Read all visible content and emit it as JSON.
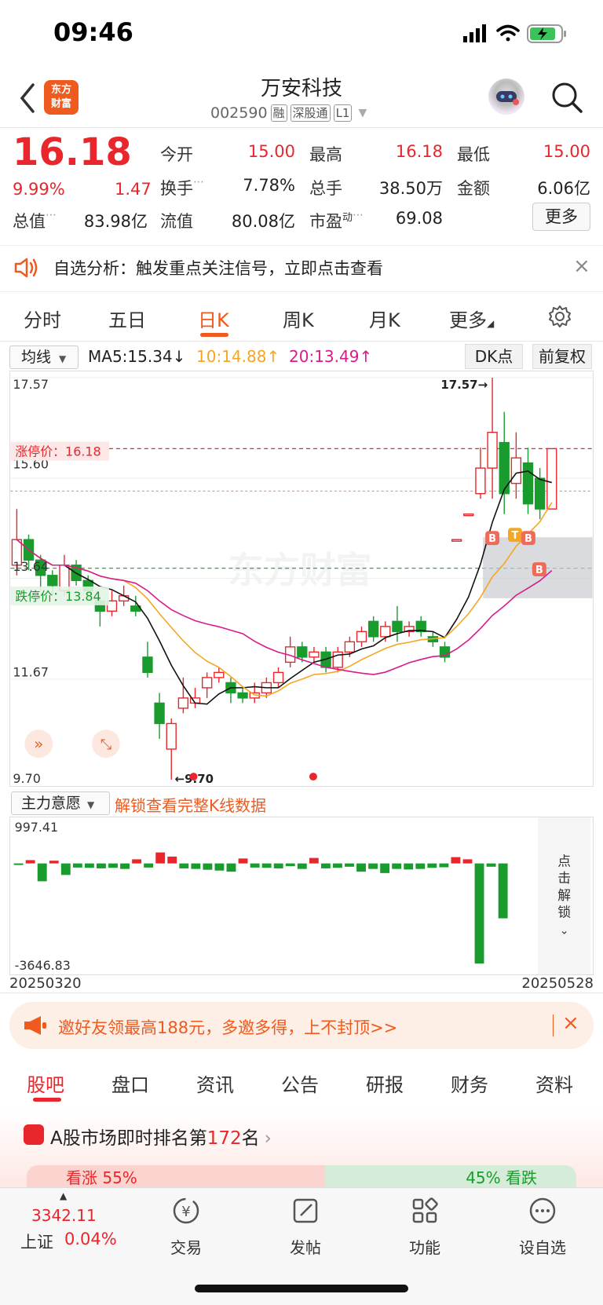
{
  "status": {
    "time": "09:46"
  },
  "header": {
    "logo_line1": "东方",
    "logo_line2": "财富",
    "stock_name": "万安科技",
    "stock_code": "002590",
    "tags": [
      "融",
      "深股通",
      "L1"
    ]
  },
  "quote": {
    "price": "16.18",
    "change_pct": "9.99%",
    "change": "1.47",
    "fields": [
      {
        "label": "今开",
        "value": "15.00",
        "color": "red"
      },
      {
        "label": "最高",
        "value": "16.18",
        "color": "red"
      },
      {
        "label": "最低",
        "value": "15.00",
        "color": "red"
      },
      {
        "label": "换手",
        "value": "7.78%",
        "color": "normal"
      },
      {
        "label": "总手",
        "value": "38.50万",
        "color": "normal"
      },
      {
        "label": "金额",
        "value": "6.06亿",
        "color": "normal"
      },
      {
        "label": "总值",
        "value": "83.98亿",
        "color": "normal"
      },
      {
        "label": "流值",
        "value": "80.08亿",
        "color": "normal"
      },
      {
        "label": "市盈",
        "value": "69.08",
        "color": "normal",
        "sup": "动"
      }
    ],
    "more_label": "更多"
  },
  "alert": {
    "text": "自选分析：触发重点关注信号，立即点击查看"
  },
  "chart_tabs": [
    "分时",
    "五日",
    "日K",
    "周K",
    "月K",
    "更多"
  ],
  "active_chart_tab": "日K",
  "ma": {
    "select_label": "均线",
    "ma5": "MA5:15.34↓",
    "ma10": "10:14.88↑",
    "ma20": "20:13.49↑"
  },
  "buttons": {
    "dk": "DK点",
    "fuquan": "前复权"
  },
  "kline": {
    "y_labels": [
      "17.57",
      "15.60",
      "13.64",
      "11.67",
      "9.70"
    ],
    "limit_up_label": "涨停价：16.18",
    "limit_down_label": "跌停价：13.84",
    "high_marker": "17.57→",
    "low_marker": "←9.70",
    "watermark": "东方财富",
    "signal_labels": [
      "B",
      "T",
      "B",
      "B"
    ]
  },
  "sub_chart": {
    "select_label": "主力意愿",
    "unlock_link": "解锁查看完整K线数据",
    "y_top": "997.41",
    "y_bottom": "-3646.83",
    "unlock_side": "点击解锁",
    "date_start": "20250320",
    "date_end": "20250528"
  },
  "chart_data": {
    "type": "candlestick",
    "title": "",
    "ylim": [
      9.7,
      17.57
    ],
    "candles": [
      {
        "o": 13.9,
        "c": 14.4,
        "h": 15.0,
        "l": 13.7
      },
      {
        "o": 14.4,
        "c": 14.0,
        "h": 14.5,
        "l": 13.8
      },
      {
        "o": 14.0,
        "c": 13.7,
        "h": 14.1,
        "l": 13.4
      },
      {
        "o": 13.7,
        "c": 13.5,
        "h": 13.8,
        "l": 13.3
      },
      {
        "o": 13.4,
        "c": 13.9,
        "h": 14.1,
        "l": 13.3
      },
      {
        "o": 13.9,
        "c": 13.6,
        "h": 14.0,
        "l": 13.5
      },
      {
        "o": 13.6,
        "c": 13.4,
        "h": 13.7,
        "l": 13.3
      },
      {
        "o": 13.2,
        "c": 13.0,
        "h": 13.3,
        "l": 12.7
      },
      {
        "o": 13.0,
        "c": 13.2,
        "h": 13.4,
        "l": 12.9
      },
      {
        "o": 13.2,
        "c": 13.3,
        "h": 13.5,
        "l": 13.1
      },
      {
        "o": 13.1,
        "c": 13.0,
        "h": 13.3,
        "l": 12.9
      },
      {
        "o": 12.1,
        "c": 11.8,
        "h": 12.4,
        "l": 11.7
      },
      {
        "o": 11.2,
        "c": 10.8,
        "h": 11.4,
        "l": 10.5
      },
      {
        "o": 10.3,
        "c": 10.8,
        "h": 10.9,
        "l": 9.7
      },
      {
        "o": 11.1,
        "c": 11.3,
        "h": 11.7,
        "l": 11.0
      },
      {
        "o": 11.2,
        "c": 11.3,
        "h": 11.5,
        "l": 11.1
      },
      {
        "o": 11.5,
        "c": 11.7,
        "h": 11.8,
        "l": 11.3
      },
      {
        "o": 11.7,
        "c": 11.8,
        "h": 11.9,
        "l": 11.6
      },
      {
        "o": 11.6,
        "c": 11.4,
        "h": 11.7,
        "l": 11.2
      },
      {
        "o": 11.4,
        "c": 11.3,
        "h": 11.5,
        "l": 11.2
      },
      {
        "o": 11.3,
        "c": 11.4,
        "h": 11.6,
        "l": 11.2
      },
      {
        "o": 11.4,
        "c": 11.6,
        "h": 11.7,
        "l": 11.3
      },
      {
        "o": 11.6,
        "c": 11.8,
        "h": 11.9,
        "l": 11.5
      },
      {
        "o": 12.0,
        "c": 12.3,
        "h": 12.5,
        "l": 11.9
      },
      {
        "o": 12.3,
        "c": 12.1,
        "h": 12.4,
        "l": 12.0
      },
      {
        "o": 12.1,
        "c": 12.2,
        "h": 12.3,
        "l": 12.0
      },
      {
        "o": 12.2,
        "c": 11.9,
        "h": 12.3,
        "l": 11.8
      },
      {
        "o": 11.9,
        "c": 12.2,
        "h": 12.3,
        "l": 11.8
      },
      {
        "o": 12.2,
        "c": 12.4,
        "h": 12.5,
        "l": 12.1
      },
      {
        "o": 12.4,
        "c": 12.6,
        "h": 12.7,
        "l": 12.3
      },
      {
        "o": 12.8,
        "c": 12.5,
        "h": 12.9,
        "l": 12.4
      },
      {
        "o": 12.5,
        "c": 12.7,
        "h": 12.8,
        "l": 12.4
      },
      {
        "o": 12.8,
        "c": 12.6,
        "h": 13.1,
        "l": 12.4
      },
      {
        "o": 12.6,
        "c": 12.7,
        "h": 12.8,
        "l": 12.5
      },
      {
        "o": 12.8,
        "c": 12.6,
        "h": 12.9,
        "l": 12.5
      },
      {
        "o": 12.5,
        "c": 12.4,
        "h": 12.6,
        "l": 12.3
      },
      {
        "o": 12.3,
        "c": 12.1,
        "h": 12.4,
        "l": 12.0
      },
      {
        "o": 14.4,
        "c": 14.4,
        "h": 14.4,
        "l": 14.4
      },
      {
        "o": 14.9,
        "c": 14.9,
        "h": 14.9,
        "l": 14.9
      },
      {
        "o": 15.3,
        "c": 15.8,
        "h": 16.2,
        "l": 15.2
      },
      {
        "o": 15.8,
        "c": 16.5,
        "h": 17.57,
        "l": 15.2
      },
      {
        "o": 16.3,
        "c": 15.3,
        "h": 16.9,
        "l": 14.9
      },
      {
        "o": 15.5,
        "c": 16.0,
        "h": 16.5,
        "l": 15.2
      },
      {
        "o": 15.9,
        "c": 15.1,
        "h": 16.2,
        "l": 14.9
      },
      {
        "o": 15.6,
        "c": 15.0,
        "h": 15.8,
        "l": 14.8
      },
      {
        "o": 15.0,
        "c": 16.18,
        "h": 16.18,
        "l": 15.0
      }
    ],
    "volume_series": {
      "name": "主力意愿",
      "ylim": [
        -3646.83,
        997.41
      ],
      "values": [
        -40,
        120,
        -650,
        100,
        -420,
        -150,
        -160,
        -180,
        -160,
        -200,
        150,
        -150,
        400,
        250,
        -180,
        -200,
        -230,
        -260,
        -300,
        180,
        -150,
        -160,
        -180,
        -100,
        -200,
        200,
        -180,
        -160,
        -120,
        -300,
        -200,
        -350,
        -200,
        -220,
        -200,
        -160,
        -140,
        230,
        150,
        -3646.83,
        -120,
        -2000
      ]
    }
  },
  "invite": {
    "text": "邀好友领最高188元，多邀多得，上不封顶>>"
  },
  "bottom_tabs": [
    "股吧",
    "盘口",
    "资讯",
    "公告",
    "研报",
    "财务",
    "资料"
  ],
  "active_bottom_tab": "股吧",
  "rank": {
    "prefix": "A股市场即时排名第",
    "rank": "172",
    "suffix": "名"
  },
  "vote": {
    "up": "看涨 55%",
    "down": "45% 看跌"
  },
  "bottom_nav": {
    "index_value": "3342.11",
    "index_name": "上证",
    "index_pct": "0.04%",
    "items": [
      {
        "label": "交易",
        "icon": "yuan-cycle-icon"
      },
      {
        "label": "发帖",
        "icon": "edit-icon"
      },
      {
        "label": "功能",
        "icon": "grid-icon"
      },
      {
        "label": "设自选",
        "icon": "dots-icon"
      }
    ]
  }
}
